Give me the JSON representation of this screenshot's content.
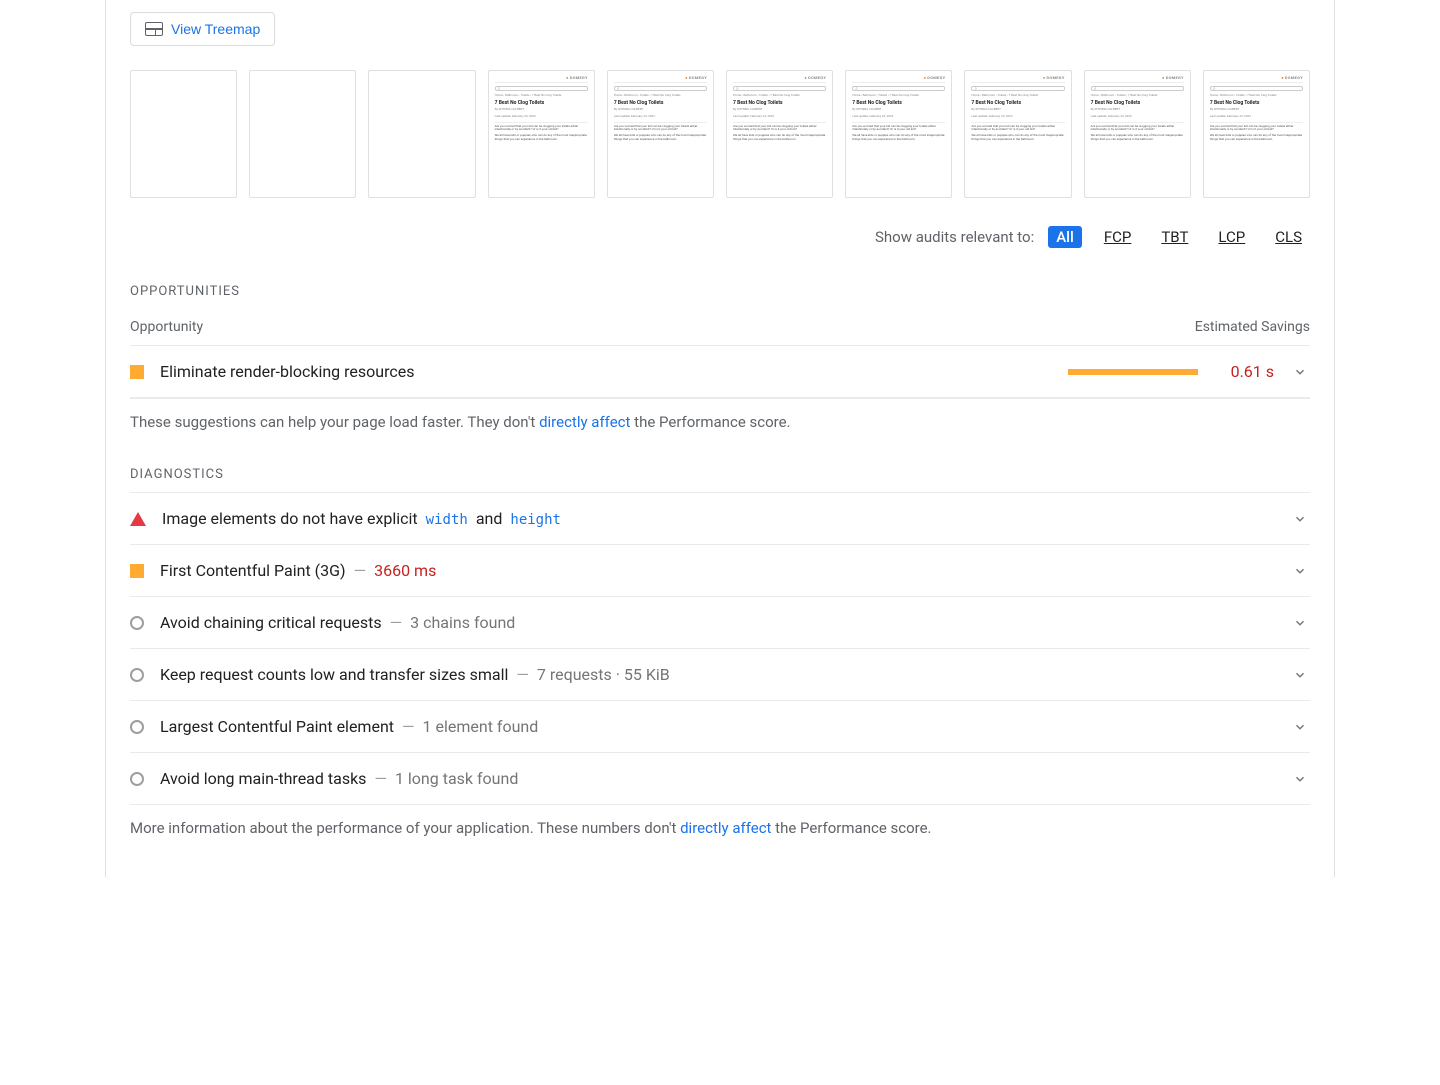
{
  "treemap_label": "View Treemap",
  "filmstrip": {
    "brand": "DOMEGY",
    "crumbs": "Home › Bathroom › Toilets › 7 Best No Clog Toilets",
    "title": "7 Best No Clog Toilets",
    "meta_author": "By SHYNNA COLBERT",
    "meta_date": "Last update: February 23, 2022",
    "p1": "Are you worried that your kid can be clogging your toilets either intentionally or by accident? Or is it your old kid?",
    "p2": "We all have kids or puppies who can do any of the most inappropriate things that you can experience in the bathroom."
  },
  "filters": {
    "label": "Show audits relevant to:",
    "all": "All",
    "fcp": "FCP",
    "tbt": "TBT",
    "lcp": "LCP",
    "cls": "CLS"
  },
  "opportunities": {
    "heading": "OPPORTUNITIES",
    "col_left": "Opportunity",
    "col_right": "Estimated Savings",
    "items": [
      {
        "label": "Eliminate render-blocking resources",
        "savings": "0.61 s",
        "bar_pct": 100
      }
    ],
    "note_pre": "These suggestions can help your page load faster. They don't ",
    "note_link": "directly affect",
    "note_post": " the Performance score."
  },
  "diagnostics": {
    "heading": "DIAGNOSTICS",
    "items": [
      {
        "badge": "tri",
        "title": "Image elements do not have explicit ",
        "code1": "width",
        "mid": " and ",
        "code2": "height",
        "sub": ""
      },
      {
        "badge": "sq",
        "title": "First Contentful Paint (3G)",
        "value_red": "3660 ms"
      },
      {
        "badge": "circ",
        "title": "Avoid chaining critical requests",
        "sub": "3 chains found"
      },
      {
        "badge": "circ",
        "title": "Keep request counts low and transfer sizes small",
        "sub": "7 requests · 55 KiB"
      },
      {
        "badge": "circ",
        "title": "Largest Contentful Paint element",
        "sub": "1 element found"
      },
      {
        "badge": "circ",
        "title": "Avoid long main-thread tasks",
        "sub": "1 long task found"
      }
    ],
    "note_pre": "More information about the performance of your application. These numbers don't ",
    "note_link": "directly affect",
    "note_post": " the Performance score."
  }
}
